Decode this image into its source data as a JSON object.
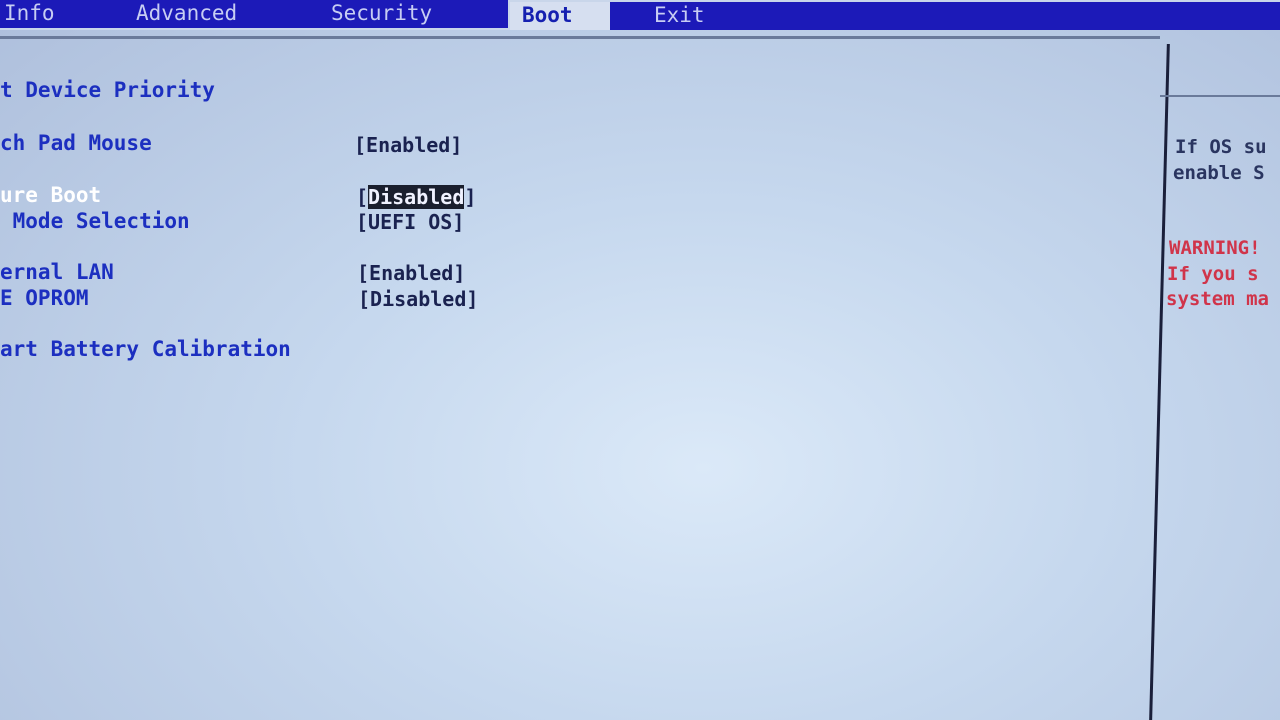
{
  "menu": {
    "tabs": [
      {
        "label": "Info"
      },
      {
        "label": "Advanced"
      },
      {
        "label": "Security"
      },
      {
        "label": "Boot",
        "active": true
      },
      {
        "label": "Exit"
      }
    ]
  },
  "settings": [
    {
      "label": "t Device Priority",
      "value": ""
    },
    {
      "label": "ch Pad Mouse",
      "value": "[Enabled]"
    },
    {
      "label": "ure Boot",
      "value_open": "[",
      "value_inner": "Disabled",
      "value_close": "]",
      "selected": true
    },
    {
      "label": " Mode Selection",
      "value": "[UEFI OS]"
    },
    {
      "label": "ernal LAN",
      "value": "[Enabled]"
    },
    {
      "label": "E OPROM",
      "value": "[Disabled]"
    },
    {
      "label": "art Battery Calibration",
      "value": ""
    }
  ],
  "help": {
    "line1": "If OS su",
    "line2": "enable S",
    "warning_title": "WARNING!",
    "warning_line1": "If you s",
    "warning_line2": "system ma"
  },
  "colors": {
    "menu_bar": "#1c1ab8",
    "item_text": "#1c2fc0",
    "warning": "#d0344a",
    "background": "#c6d8ee"
  }
}
